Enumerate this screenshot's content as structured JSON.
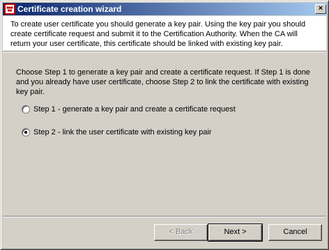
{
  "window": {
    "title": "Certificate creation wizard",
    "close_glyph": "×"
  },
  "header": {
    "text": "To create user certificate you should generate a key pair. Using the key pair you should create certificate request and submit it to the Certification Authority. When the CA will return your user certificate, this certificate should be linked with existing key pair."
  },
  "body": {
    "instructions": "Choose Step 1 to generate a key pair and create a certificate request. If Step 1 is done and you already have user certificate, choose Step 2 to link the certificate with existing key pair.",
    "options": [
      {
        "label": "Step 1 - generate a key pair and create a certificate request",
        "selected": false
      },
      {
        "label": "Step 2 - link the user certificate with existing key pair",
        "selected": true
      }
    ]
  },
  "buttons": {
    "back": "< Back",
    "next": "Next >",
    "cancel": "Cancel"
  },
  "colors": {
    "titlebar_start": "#0a246a",
    "titlebar_end": "#a6caf0",
    "face": "#d4d0c8"
  },
  "icons": {
    "app": "certificate-app-icon",
    "close": "close-icon"
  }
}
